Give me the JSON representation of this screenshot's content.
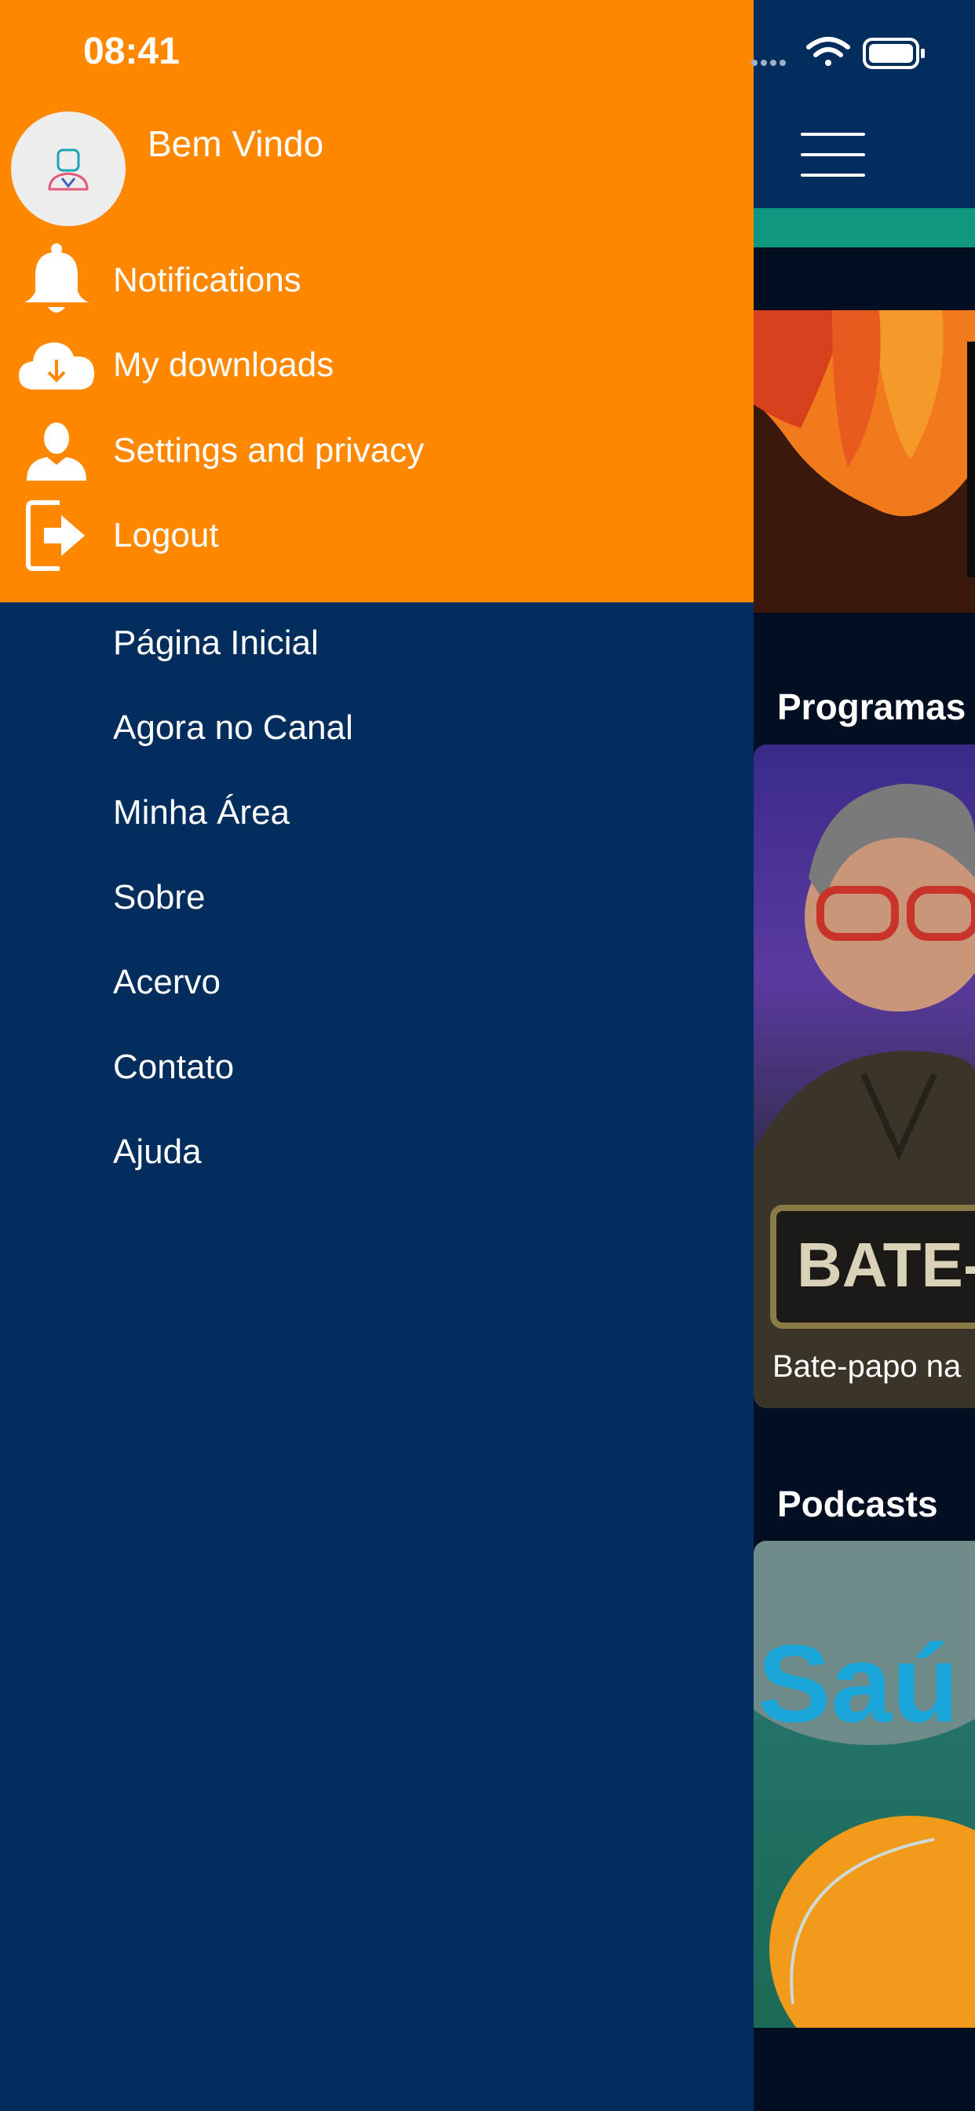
{
  "status_bar": {
    "time": "08:41"
  },
  "drawer": {
    "welcome": "Bem Vindo",
    "account_items": [
      {
        "label": "Notifications",
        "icon": "bell-icon"
      },
      {
        "label": "My downloads",
        "icon": "cloud-download-icon"
      },
      {
        "label": "Settings and privacy",
        "icon": "user-icon"
      },
      {
        "label": "Logout",
        "icon": "logout-icon"
      }
    ],
    "nav_items": [
      "Página Inicial",
      "Agora no Canal",
      "Minha Área",
      "Sobre",
      "Acervo",
      "Contato",
      "Ajuda"
    ]
  },
  "background": {
    "sections": [
      {
        "title": "Programas",
        "card_caption": "Bate-papo na"
      },
      {
        "title": "Podcasts"
      }
    ],
    "card_logo_text": "BATE-P"
  },
  "colors": {
    "drawer_top": "#ff8800",
    "drawer_body": "#022d5c",
    "teal_bar": "#10977f"
  }
}
